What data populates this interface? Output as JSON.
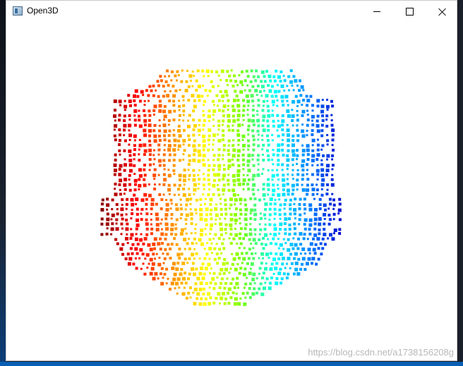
{
  "window": {
    "title": "Open3D",
    "icon": "open3d-app-icon"
  },
  "title_buttons": {
    "minimize": "minimize-icon",
    "maximize": "maximize-icon",
    "close": "close-icon"
  },
  "viewport": {
    "background": "#ffffff",
    "content": "point-cloud",
    "colormap": [
      "#8b0000",
      "#ff0000",
      "#ff8c00",
      "#ffff00",
      "#7fff00",
      "#00ffff",
      "#0080ff",
      "#0000cd"
    ]
  },
  "watermark": "https://blog.csdn.net/a1738156208g"
}
